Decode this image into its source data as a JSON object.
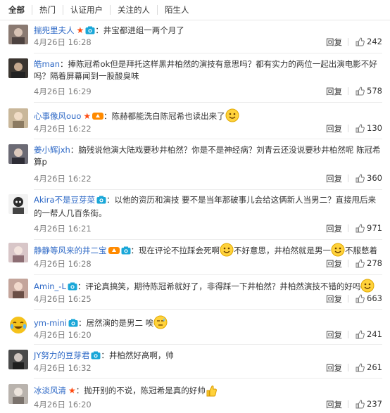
{
  "tabs": [
    "全部",
    "热门",
    "认证用户",
    "关注的人",
    "陌生人"
  ],
  "actions": {
    "reply": "回复"
  },
  "comments": [
    {
      "user": "揣兜里夫人",
      "text": "：井宝都进组一两个月了",
      "time": "4月26日 16:28",
      "likes": "242",
      "avatar_color": "#8a7a72"
    },
    {
      "user": "皓man",
      "text": "：捧陈冠希ok但是拜托这样黑井柏然的演技有意思吗？都有实力的两位一起出演电影不好吗？隔着屏幕闻到一股酸臭味",
      "time": "4月26日 16:29",
      "likes": "578",
      "avatar_color": "#3a3530"
    },
    {
      "user": "心事像风ouo",
      "text": "：陈赫都能洗白陈冠希也读出来了",
      "time": "4月26日 16:22",
      "likes": "130",
      "avatar_color": "#c9b79a"
    },
    {
      "user": "姜小辉jxh",
      "text": "：脑残说他演大陆戏要秒井柏然？你是不是神经病？刘青云还没说要秒井柏然呢 陈冠希算p",
      "time": "4月26日 16:22",
      "likes": "360",
      "avatar_color": "#6b6a74"
    },
    {
      "user": "Akira不是豆芽菜",
      "text": "：以他的资历和演技 要不是当年那破事儿会给这俩新人当男二？直接甩后来的一帮人几百条街。",
      "time": "4月26日 16:21",
      "likes": "971",
      "avatar_color": "#2b2b2b"
    },
    {
      "user": "静静等风来的井二宝",
      "text_a": "：现在评论不拉踩会死啊",
      "text_b": "不好意思，井柏然就是男一",
      "text_c": "不服憋着",
      "time": "4月26日 16:28",
      "likes": "278",
      "avatar_color": "#d8c6c8"
    },
    {
      "user": "Amin_-L",
      "text": "：评论真搞笑，期待陈冠希就好了，非得踩一下井柏然？井柏然演技不错的好吗",
      "time": "4月26日 16:25",
      "likes": "663",
      "avatar_color": "#c4a59b"
    },
    {
      "user": "ym-mini",
      "text": "：居然演的是男二 唉",
      "time": "4月26日 16:20",
      "likes": "241",
      "avatar_color": "#f5c21b"
    },
    {
      "user": "JY努力的豆芽君",
      "text": "：井柏然好高啊，帅",
      "time": "4月26日 16:32",
      "likes": "261",
      "avatar_color": "#4a4a4a"
    },
    {
      "user": "冰淡风清",
      "text": "：抛开别的不说，陈冠希是真的好帅",
      "time": "4月26日 16:20",
      "likes": "237",
      "avatar_color": "#b9b3ad"
    }
  ]
}
